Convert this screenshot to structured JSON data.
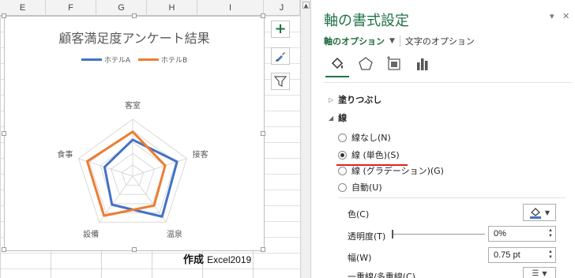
{
  "sheet": {
    "columns": [
      "E",
      "F",
      "G",
      "H",
      "I",
      "J"
    ]
  },
  "chart": {
    "title": "顧客満足度アンケート結果",
    "legend": [
      {
        "name": "ホテルA",
        "color": "#4472c4"
      },
      {
        "name": "ホテルB",
        "color": "#ed7d31"
      }
    ],
    "credit_prefix": "作成",
    "credit_app": "Excel2019",
    "side_buttons": [
      "plus-icon",
      "brush-icon",
      "filter-icon"
    ]
  },
  "chart_data": {
    "type": "radar",
    "title": "顧客満足度アンケート結果",
    "categories": [
      "客室",
      "接客",
      "温泉",
      "設備",
      "食事"
    ],
    "series": [
      {
        "name": "ホテルA",
        "values": [
          3.2,
          4.1,
          4.4,
          3.1,
          2.6
        ]
      },
      {
        "name": "ホテルB",
        "values": [
          3.9,
          3.0,
          3.2,
          4.3,
          4.2
        ]
      }
    ],
    "rmax": 5,
    "gridlines": 5,
    "legend_position": "top"
  },
  "pane": {
    "title": "軸の書式設定",
    "tab_axis_options": "軸のオプション",
    "tab_text_options": "文字のオプション",
    "section_fill": "塗りつぶし",
    "section_line": "線",
    "radio_options": [
      {
        "label": "線なし(N)",
        "checked": false
      },
      {
        "label": "線 (単色)(S)",
        "checked": true
      },
      {
        "label": "線 (グラデーション)(G)",
        "checked": false
      },
      {
        "label": "自動(U)",
        "checked": false
      }
    ],
    "color_label": "色(C)",
    "transparency_label": "透明度(T)",
    "transparency_value": "0%",
    "width_label": "幅(W)",
    "width_value": "0.75 pt",
    "compound_label": "一重線/多重線(C)",
    "accent_color": "#217346"
  }
}
